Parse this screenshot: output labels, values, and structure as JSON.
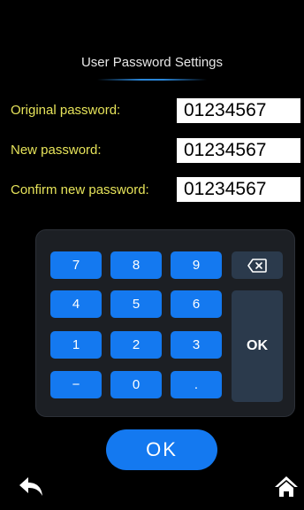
{
  "title": "User Password Settings",
  "fields": [
    {
      "label": "Original password:",
      "value": "01234567"
    },
    {
      "label": "New password:",
      "value": "01234567"
    },
    {
      "label": "Confirm new password:",
      "value": "01234567"
    }
  ],
  "keypad": {
    "keys": [
      "7",
      "8",
      "9",
      "4",
      "5",
      "6",
      "1",
      "2",
      "3",
      "−",
      "0",
      "."
    ],
    "backspace_icon": "backspace-icon",
    "ok_label": "OK"
  },
  "confirm_button": "OK",
  "icons": {
    "back": "back-arrow-icon",
    "home": "home-icon"
  },
  "colors": {
    "accent": "#1479f0",
    "label": "#e6e35a",
    "background": "#000000",
    "keypad_bg": "#1c1f24",
    "gray_key": "#2b3a4c"
  }
}
